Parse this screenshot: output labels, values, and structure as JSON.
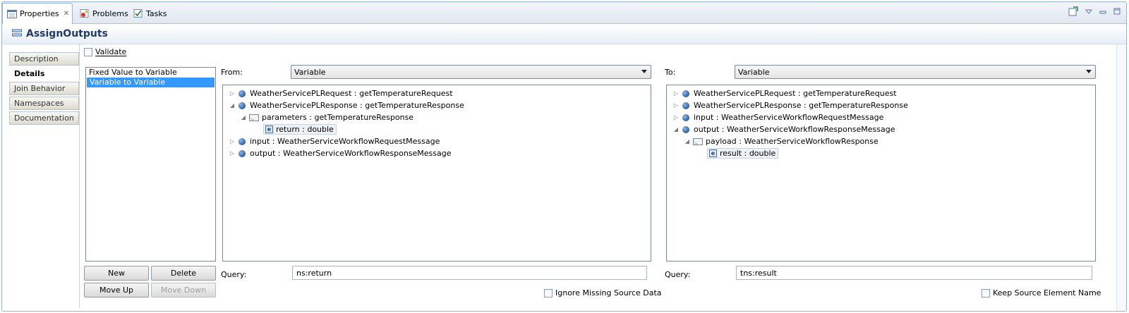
{
  "tabs": [
    {
      "label": "Properties",
      "icon": "properties-icon"
    },
    {
      "label": "Problems",
      "icon": "problems-icon"
    },
    {
      "label": "Tasks",
      "icon": "tasks-icon"
    }
  ],
  "header": {
    "title": "AssignOutputs"
  },
  "side_tabs": [
    "Description",
    "Details",
    "Join Behavior",
    "Namespaces",
    "Documentation"
  ],
  "validate": {
    "label": "Validate",
    "checked": false
  },
  "copy_list": [
    "Fixed Value to Variable",
    "Variable to Variable"
  ],
  "buttons": {
    "new": "New",
    "delete": "Delete",
    "move_up": "Move Up",
    "move_down": "Move Down"
  },
  "from": {
    "label": "From:",
    "select_value": "Variable",
    "tree": [
      {
        "text": "WeatherServicePLRequest : getTemperatureRequest"
      },
      {
        "text": "WeatherServicePLResponse : getTemperatureResponse"
      },
      {
        "text": "parameters : getTemperatureResponse"
      },
      {
        "text": "return : double"
      },
      {
        "text": "input : WeatherServiceWorkflowRequestMessage"
      },
      {
        "text": "output : WeatherServiceWorkflowResponseMessage"
      }
    ],
    "query_label": "Query:",
    "query_value": "ns:return",
    "checkbox_label": "Ignore Missing Source Data"
  },
  "to": {
    "label": "To:",
    "select_value": "Variable",
    "tree": [
      {
        "text": "WeatherServicePLRequest : getTemperatureRequest"
      },
      {
        "text": "WeatherServicePLResponse : getTemperatureResponse"
      },
      {
        "text": "input : WeatherServiceWorkflowRequestMessage"
      },
      {
        "text": "output : WeatherServiceWorkflowResponseMessage"
      },
      {
        "text": "payload : WeatherServiceWorkflowResponse"
      },
      {
        "text": "result : double"
      }
    ],
    "query_label": "Query:",
    "query_value": "tns:result",
    "checkbox_label": "Keep Source Element Name"
  },
  "colors": {
    "selection": "#3399ff",
    "title": "#1f3a6b",
    "border": "#99b4d1"
  }
}
